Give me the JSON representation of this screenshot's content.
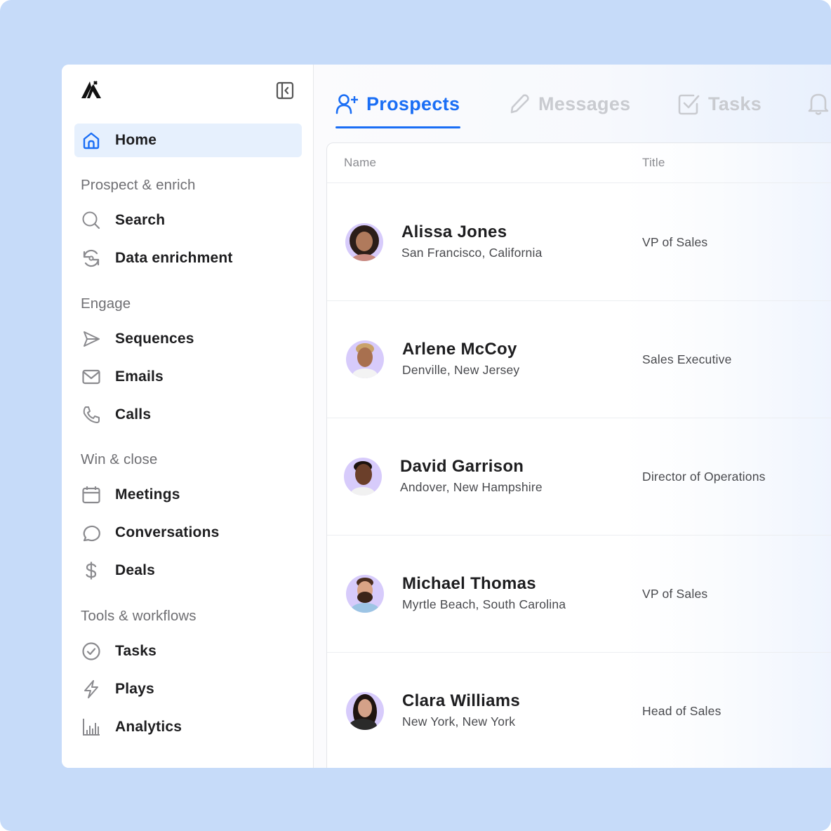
{
  "app": {
    "logo": "logo-icon",
    "collapse_icon": "sidebar-collapse-icon"
  },
  "sidebar": {
    "home": {
      "label": "Home",
      "icon": "home-icon",
      "active": true
    },
    "sections": [
      {
        "label": "Prospect & enrich",
        "items": [
          {
            "label": "Search",
            "icon": "search-icon"
          },
          {
            "label": "Data enrichment",
            "icon": "refresh-cycle-icon"
          }
        ]
      },
      {
        "label": "Engage",
        "items": [
          {
            "label": "Sequences",
            "icon": "send-icon"
          },
          {
            "label": "Emails",
            "icon": "mail-icon"
          },
          {
            "label": "Calls",
            "icon": "phone-icon"
          }
        ]
      },
      {
        "label": "Win & close",
        "items": [
          {
            "label": "Meetings",
            "icon": "calendar-icon"
          },
          {
            "label": "Conversations",
            "icon": "chat-bubble-icon"
          },
          {
            "label": "Deals",
            "icon": "dollar-icon"
          }
        ]
      },
      {
        "label": "Tools & workflows",
        "items": [
          {
            "label": "Tasks",
            "icon": "check-circle-icon"
          },
          {
            "label": "Plays",
            "icon": "lightning-icon"
          },
          {
            "label": "Analytics",
            "icon": "bar-chart-icon"
          }
        ]
      }
    ]
  },
  "tabs": [
    {
      "label": "Prospects",
      "icon": "user-plus-icon",
      "active": true
    },
    {
      "label": "Messages",
      "icon": "pencil-icon",
      "active": false
    },
    {
      "label": "Tasks",
      "icon": "checkbox-icon",
      "active": false
    },
    {
      "label": "",
      "icon": "bell-icon",
      "active": false
    }
  ],
  "table": {
    "columns": [
      "Name",
      "Title"
    ],
    "rows": [
      {
        "name": "Alissa Jones",
        "location": "San Francisco, California",
        "title": "VP of Sales"
      },
      {
        "name": "Arlene McCoy",
        "location": "Denville, New Jersey",
        "title": "Sales Executive"
      },
      {
        "name": "David Garrison",
        "location": "Andover, New Hampshire",
        "title": "Director of Operations"
      },
      {
        "name": "Michael Thomas",
        "location": "Myrtle Beach, South Carolina",
        "title": "VP of Sales"
      },
      {
        "name": "Clara Williams",
        "location": "New York, New York",
        "title": "Head of Sales"
      }
    ]
  },
  "colors": {
    "accent": "#1a6ef5",
    "background": "#c6dbf9",
    "active_nav_bg": "#e6f0fd",
    "avatar_bg": "#d7cbfb"
  }
}
